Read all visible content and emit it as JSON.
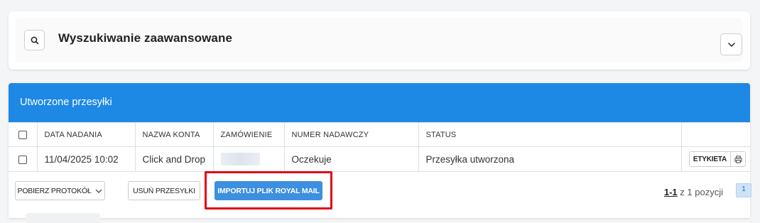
{
  "search": {
    "title": "Wyszukiwanie zaawansowane"
  },
  "shipments": {
    "title": "Utworzone przesyłki",
    "columns": [
      "DATA NADANIA",
      "NAZWA KONTA",
      "ZAMÓWIENIE",
      "NUMER NADAWCZY",
      "STATUS"
    ],
    "rows": [
      {
        "date": "11/04/2025 10:02",
        "account": "Click and Drop",
        "order": "",
        "tracking": "Oczekuje",
        "status": "Przesyłka utworzona",
        "label_button": "ETYKIETA"
      }
    ]
  },
  "actions": {
    "protocol_label": "POBIERZ PROTOKÓŁ",
    "delete_label": "USUŃ PRZESYŁKI",
    "import_label": "IMPORTUJ PLIK ROYAL MAIL"
  },
  "pagination": {
    "range": "1-1",
    "of_text": "z 1 pozycji",
    "current_page": "1"
  },
  "colors": {
    "header_blue": "#1e88e5",
    "import_button": "#3d8fe0",
    "highlight": "#e30613"
  },
  "icons": [
    "search-icon",
    "chevron-down-icon",
    "printer-icon"
  ]
}
